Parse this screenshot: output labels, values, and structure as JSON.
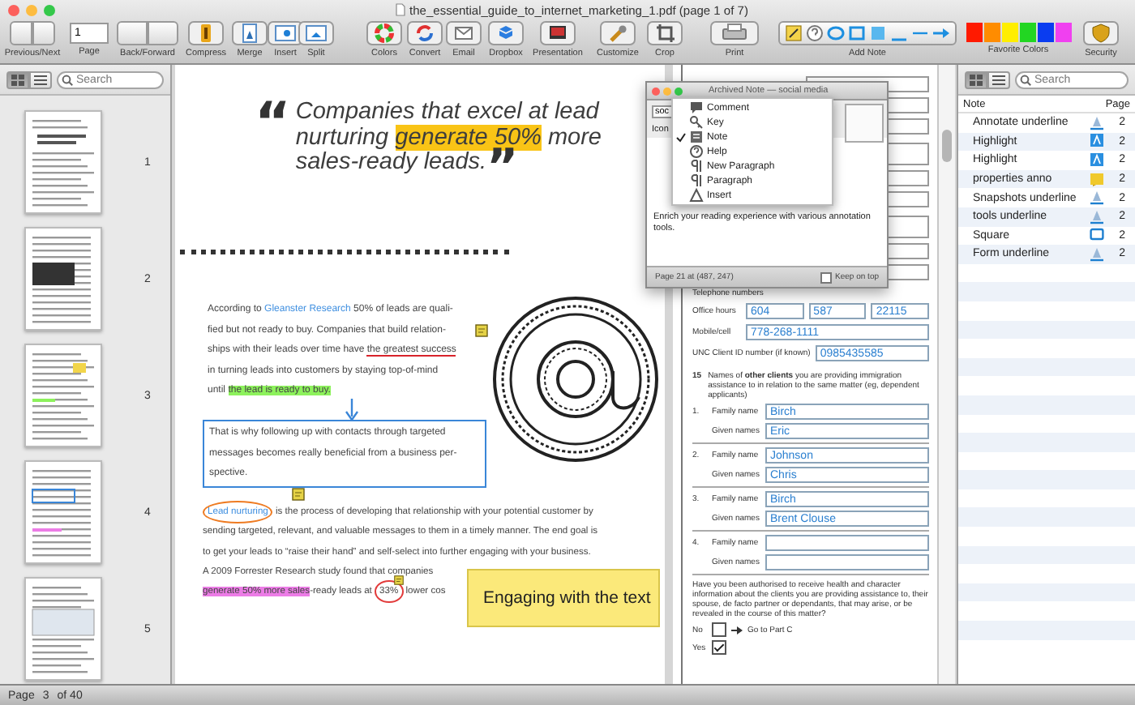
{
  "window": {
    "title": "the_essential_guide_to_internet_marketing_1.pdf (page 1 of 7)"
  },
  "toolbar": {
    "items": [
      {
        "label": "Previous/Next",
        "kind": "segmented"
      },
      {
        "label": "Page",
        "kind": "page_field",
        "value": "1"
      },
      {
        "label": "Back/Forward",
        "kind": "segmented"
      },
      {
        "label": "Compress",
        "kind": "tool"
      },
      {
        "label": "Merge",
        "kind": "tool"
      },
      {
        "label": "Insert",
        "kind": "tool"
      },
      {
        "label": "Split",
        "kind": "tool"
      },
      {
        "label": "Colors",
        "kind": "tool"
      },
      {
        "label": "Convert",
        "kind": "tool"
      },
      {
        "label": "Email",
        "kind": "tool"
      },
      {
        "label": "Dropbox",
        "kind": "tool"
      },
      {
        "label": "Presentation",
        "kind": "tool"
      },
      {
        "label": "Customize",
        "kind": "tool"
      },
      {
        "label": "Crop",
        "kind": "tool"
      },
      {
        "label": "Print",
        "kind": "tool"
      },
      {
        "label": "Add Note",
        "kind": "note_tools"
      },
      {
        "label": "Favorite Colors",
        "kind": "swatches",
        "swatches": [
          {
            "color": "#ff1a00"
          },
          {
            "color": "#ff8c00"
          },
          {
            "color": "#ffee00"
          },
          {
            "color": "#22d622"
          },
          {
            "color": "#0a3cf0"
          },
          {
            "color": "#f040f0"
          }
        ]
      },
      {
        "label": "Security",
        "kind": "tool"
      }
    ]
  },
  "sidebar": {
    "view_modes": [
      {
        "selected": true
      },
      {
        "selected": false
      }
    ],
    "search": {
      "placeholder": "Search"
    },
    "pages": [
      {
        "number": "1"
      },
      {
        "number": "2"
      },
      {
        "number": "3"
      },
      {
        "number": "4"
      },
      {
        "number": "5"
      }
    ]
  },
  "document": {
    "quote": {
      "open_mark": "“",
      "close_mark": "”",
      "lines": [
        [
          {
            "text": "Companies that excel at lead"
          }
        ],
        [
          {
            "text": "nurturing "
          },
          {
            "text": "generate 50%",
            "kind": "highlight",
            "color": "#f9c416"
          },
          {
            "text": " more"
          }
        ],
        [
          {
            "text": "sales-ready leads."
          }
        ]
      ]
    },
    "paragraphs": [
      {
        "kind": "plain",
        "lines": [
          [
            {
              "text": "According to "
            },
            {
              "text": "Gleanster Research",
              "link": true
            },
            {
              "text": " 50% of leads are quali-"
            }
          ],
          [
            {
              "text": "fied but not ready to buy. Companies that build relation-"
            }
          ],
          [
            {
              "text": "ships with their leads over time have "
            },
            {
              "text": "the greatest success",
              "kind": "underline",
              "color": "#d8232a"
            }
          ],
          [
            {
              "text": "in turning leads into customers by staying top-of-mind"
            }
          ],
          [
            {
              "text": "until "
            },
            {
              "text": "the lead is ready to buy.",
              "kind": "highlight",
              "color": "#8df25c"
            }
          ]
        ]
      },
      {
        "kind": "boxed",
        "lines": [
          [
            {
              "text": "That is why following up with contacts through targeted"
            }
          ],
          [
            {
              "text": "messages becomes really beneficial from a business per-"
            }
          ],
          [
            {
              "text": "spective."
            }
          ]
        ]
      },
      {
        "kind": "plain",
        "lines": [
          [
            {
              "text": "Lead nurturing",
              "link": true,
              "kind": "circle",
              "color": "#ee7b22"
            },
            {
              "text": " is the process of developing that relationship with your potential customer by"
            }
          ],
          [
            {
              "text": "sending targeted, relevant, and valuable messages to them in a timely manner. The end goal is"
            }
          ],
          [
            {
              "text": "to get your leads to “raise their hand” and self-select into further engaging with your business."
            }
          ],
          [
            {
              "text": "A 2009 Forrester Research study found that companies"
            }
          ],
          [
            {
              "text": "generate 50% more sales",
              "kind": "highlight",
              "color": "#ec7ce6"
            },
            {
              "text": "-ready leads at "
            },
            {
              "text": "33%",
              "kind": "circle",
              "color": "#e23b3b"
            },
            {
              "text": " lower cos"
            }
          ]
        ]
      }
    ],
    "sticky_note": "Engaging with the text"
  },
  "form": {
    "phone": {
      "heading": "Telephone numbers",
      "rows": [
        {
          "label": "Office hours",
          "values": [
            "604",
            "587",
            "22115"
          ]
        },
        {
          "label": "Mobile/cell",
          "values": [
            "778-268-1111"
          ]
        },
        {
          "label": "UNC Client ID number (if known)",
          "values": [
            "0985435585"
          ]
        }
      ]
    },
    "question": {
      "number": "15",
      "text": "Names of **other clients** you are providing immigration assistance to in relation to the same matter (eg, dependent applicants)"
    },
    "clients": [
      {
        "number": "1.",
        "family_label": "Family name",
        "family": "Birch",
        "given_label": "Given names",
        "given": "Eric"
      },
      {
        "number": "2.",
        "family_label": "Family name",
        "family": "Johnson",
        "given_label": "Given names",
        "given": "Chris"
      },
      {
        "number": "3.",
        "family_label": "Family name",
        "family": "Birch",
        "given_label": "Given names",
        "given": "Brent Clouse"
      },
      {
        "number": "4.",
        "family_label": "Family name",
        "given_label": "Given names"
      }
    ],
    "health": {
      "text": "Have you been authorised to receive health and character information about the clients you are providing assistance to, their spouse, de facto partner or dependants, that may arise, or be revealed in the course of this matter?",
      "options": [
        {
          "label": "No",
          "checked": false
        },
        {
          "label": "Yes",
          "checked": true
        }
      ],
      "goto": "Go to Part C"
    }
  },
  "note_popup": {
    "title": "Archived Note — social media",
    "title_value": "soc",
    "icon_label": "Icon",
    "menu": [
      {
        "label": "Comment",
        "checked": false
      },
      {
        "label": "Key",
        "checked": false
      },
      {
        "label": "Note",
        "checked": true
      },
      {
        "label": "Help",
        "checked": false
      },
      {
        "label": "New Paragraph",
        "checked": false
      },
      {
        "label": "Paragraph",
        "checked": false
      },
      {
        "label": "Insert",
        "checked": false
      }
    ],
    "body": "Enrich your reading experience with various annotation tools.",
    "location": "Page 21 at (487, 247)",
    "keep_on_top": {
      "label": "Keep on top",
      "checked": false
    }
  },
  "notes_panel": {
    "view_modes": [
      {
        "selected": true
      },
      {
        "selected": false
      }
    ],
    "search": {
      "placeholder": "Search"
    },
    "columns": [
      "Note",
      "Page"
    ],
    "rows": [
      {
        "note": "Annotate underline",
        "kind": "underline",
        "page": "2"
      },
      {
        "note": "Highlight",
        "kind": "highlight",
        "page": "2"
      },
      {
        "note": "Highlight",
        "kind": "highlight",
        "page": "2"
      },
      {
        "note": "properties anno",
        "kind": "note",
        "page": "2"
      },
      {
        "note": "Snapshots underline",
        "kind": "underline",
        "page": "2"
      },
      {
        "note": "tools underline",
        "kind": "underline",
        "page": "2"
      },
      {
        "note": "Square",
        "kind": "square",
        "page": "2"
      },
      {
        "note": "Form underline",
        "kind": "underline",
        "page": "2"
      }
    ]
  },
  "status_bar": {
    "label": "Page",
    "page": "3",
    "total": "of 40"
  }
}
